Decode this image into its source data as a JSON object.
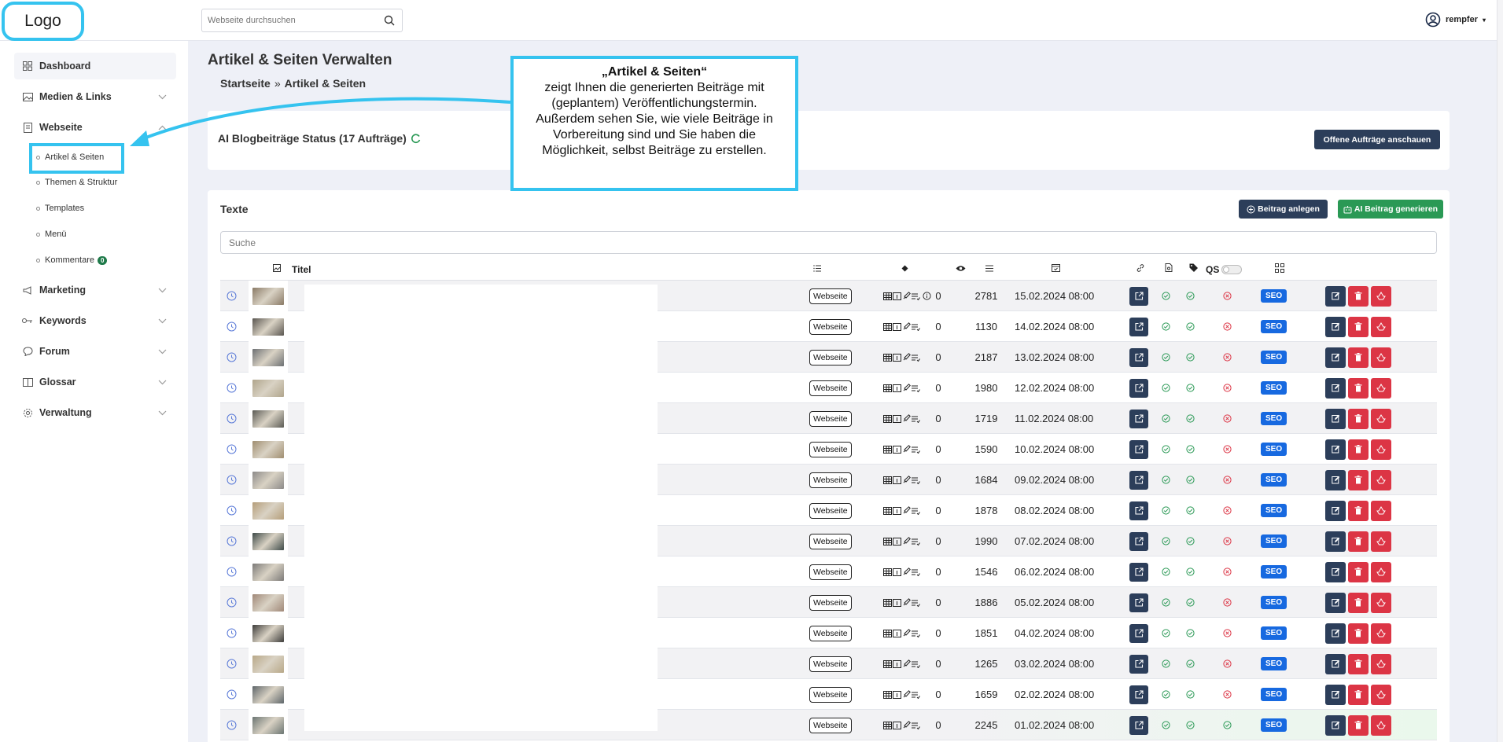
{
  "header": {
    "logo": "Logo",
    "search_placeholder": "Webseite durchsuchen",
    "user_name": "rempfer"
  },
  "sidebar": {
    "items": [
      {
        "label": "Dashboard",
        "icon": "grid-icon"
      },
      {
        "label": "Medien & Links",
        "icon": "image-icon"
      },
      {
        "label": "Webseite",
        "icon": "page-icon"
      },
      {
        "label": "Marketing",
        "icon": "megaphone-icon"
      },
      {
        "label": "Keywords",
        "icon": "key-icon"
      },
      {
        "label": "Forum",
        "icon": "chat-icon"
      },
      {
        "label": "Glossar",
        "icon": "book-icon"
      },
      {
        "label": "Verwaltung",
        "icon": "gear-icon"
      }
    ],
    "subitems": [
      "Artikel & Seiten",
      "Themen & Struktur",
      "Templates",
      "Menü",
      "Kommentare"
    ],
    "kommentare_badge": "0"
  },
  "main": {
    "title": "Artikel & Seiten Verwalten",
    "breadcrumb": [
      "Startseite",
      "Artikel & Seiten"
    ],
    "breadcrumb_sep": "»",
    "status_text": "AI Blogbeiträge Status (17 Aufträge)",
    "open_orders_button": "Offene Aufträge anschauen",
    "texts_title": "Texte",
    "new_post_button": "Beitrag anlegen",
    "ai_post_button": "AI Beitrag generieren",
    "table_search_placeholder": "Suche",
    "col_title": "Titel",
    "col_qs": "QS"
  },
  "callout": {
    "title": "„Artikel & Seiten“",
    "body": "zeigt Ihnen die generierten Beiträge mit (geplantem) Veröffentlichungstermin. Außerdem sehen Sie, wie viele Beiträge in Vorbereitung sind und Sie haben die Möglichkeit, selbst Beiträge zu erstellen."
  },
  "colors": {
    "accent": "#35c3ef",
    "dark_button": "#2c3e5a",
    "green_button": "#2a9955",
    "red_button": "#dc3545",
    "seo_badge": "#1769e0"
  },
  "rows": [
    {
      "type": "Webseite",
      "views": "0",
      "words": "2781",
      "date": "15.02.2024 08:00",
      "seo": "SEO",
      "thumb": "#8a7a66",
      "qs_ok": false
    },
    {
      "type": "Webseite",
      "views": "0",
      "words": "1130",
      "date": "14.02.2024 08:00",
      "seo": "SEO",
      "thumb": "#5a5650",
      "qs_ok": false
    },
    {
      "type": "Webseite",
      "views": "0",
      "words": "2187",
      "date": "13.02.2024 08:00",
      "seo": "SEO",
      "thumb": "#6d7073",
      "qs_ok": false
    },
    {
      "type": "Webseite",
      "views": "0",
      "words": "1980",
      "date": "12.02.2024 08:00",
      "seo": "SEO",
      "thumb": "#b0a58c",
      "qs_ok": false
    },
    {
      "type": "Webseite",
      "views": "0",
      "words": "1719",
      "date": "11.02.2024 08:00",
      "seo": "SEO",
      "thumb": "#5b5b55",
      "qs_ok": false
    },
    {
      "type": "Webseite",
      "views": "0",
      "words": "1590",
      "date": "10.02.2024 08:00",
      "seo": "SEO",
      "thumb": "#a08e70",
      "qs_ok": false
    },
    {
      "type": "Webseite",
      "views": "0",
      "words": "1684",
      "date": "09.02.2024 08:00",
      "seo": "SEO",
      "thumb": "#8c8a88",
      "qs_ok": false
    },
    {
      "type": "Webseite",
      "views": "0",
      "words": "1878",
      "date": "08.02.2024 08:00",
      "seo": "SEO",
      "thumb": "#b59e7a",
      "qs_ok": false
    },
    {
      "type": "Webseite",
      "views": "0",
      "words": "1990",
      "date": "07.02.2024 08:00",
      "seo": "SEO",
      "thumb": "#3e4a48",
      "qs_ok": false
    },
    {
      "type": "Webseite",
      "views": "0",
      "words": "1546",
      "date": "06.02.2024 08:00",
      "seo": "SEO",
      "thumb": "#7c7a78",
      "qs_ok": false
    },
    {
      "type": "Webseite",
      "views": "0",
      "words": "1886",
      "date": "05.02.2024 08:00",
      "seo": "SEO",
      "thumb": "#a08878",
      "qs_ok": false
    },
    {
      "type": "Webseite",
      "views": "0",
      "words": "1851",
      "date": "04.02.2024 08:00",
      "seo": "SEO",
      "thumb": "#3d3c3a",
      "qs_ok": false
    },
    {
      "type": "Webseite",
      "views": "0",
      "words": "1265",
      "date": "03.02.2024 08:00",
      "seo": "SEO",
      "thumb": "#b8a888",
      "qs_ok": false
    },
    {
      "type": "Webseite",
      "views": "0",
      "words": "1659",
      "date": "02.02.2024 08:00",
      "seo": "SEO",
      "thumb": "#5e666a",
      "qs_ok": false
    },
    {
      "type": "Webseite",
      "views": "0",
      "words": "2245",
      "date": "01.02.2024 08:00",
      "seo": "SEO",
      "thumb": "#6b7572",
      "qs_ok": true
    }
  ]
}
